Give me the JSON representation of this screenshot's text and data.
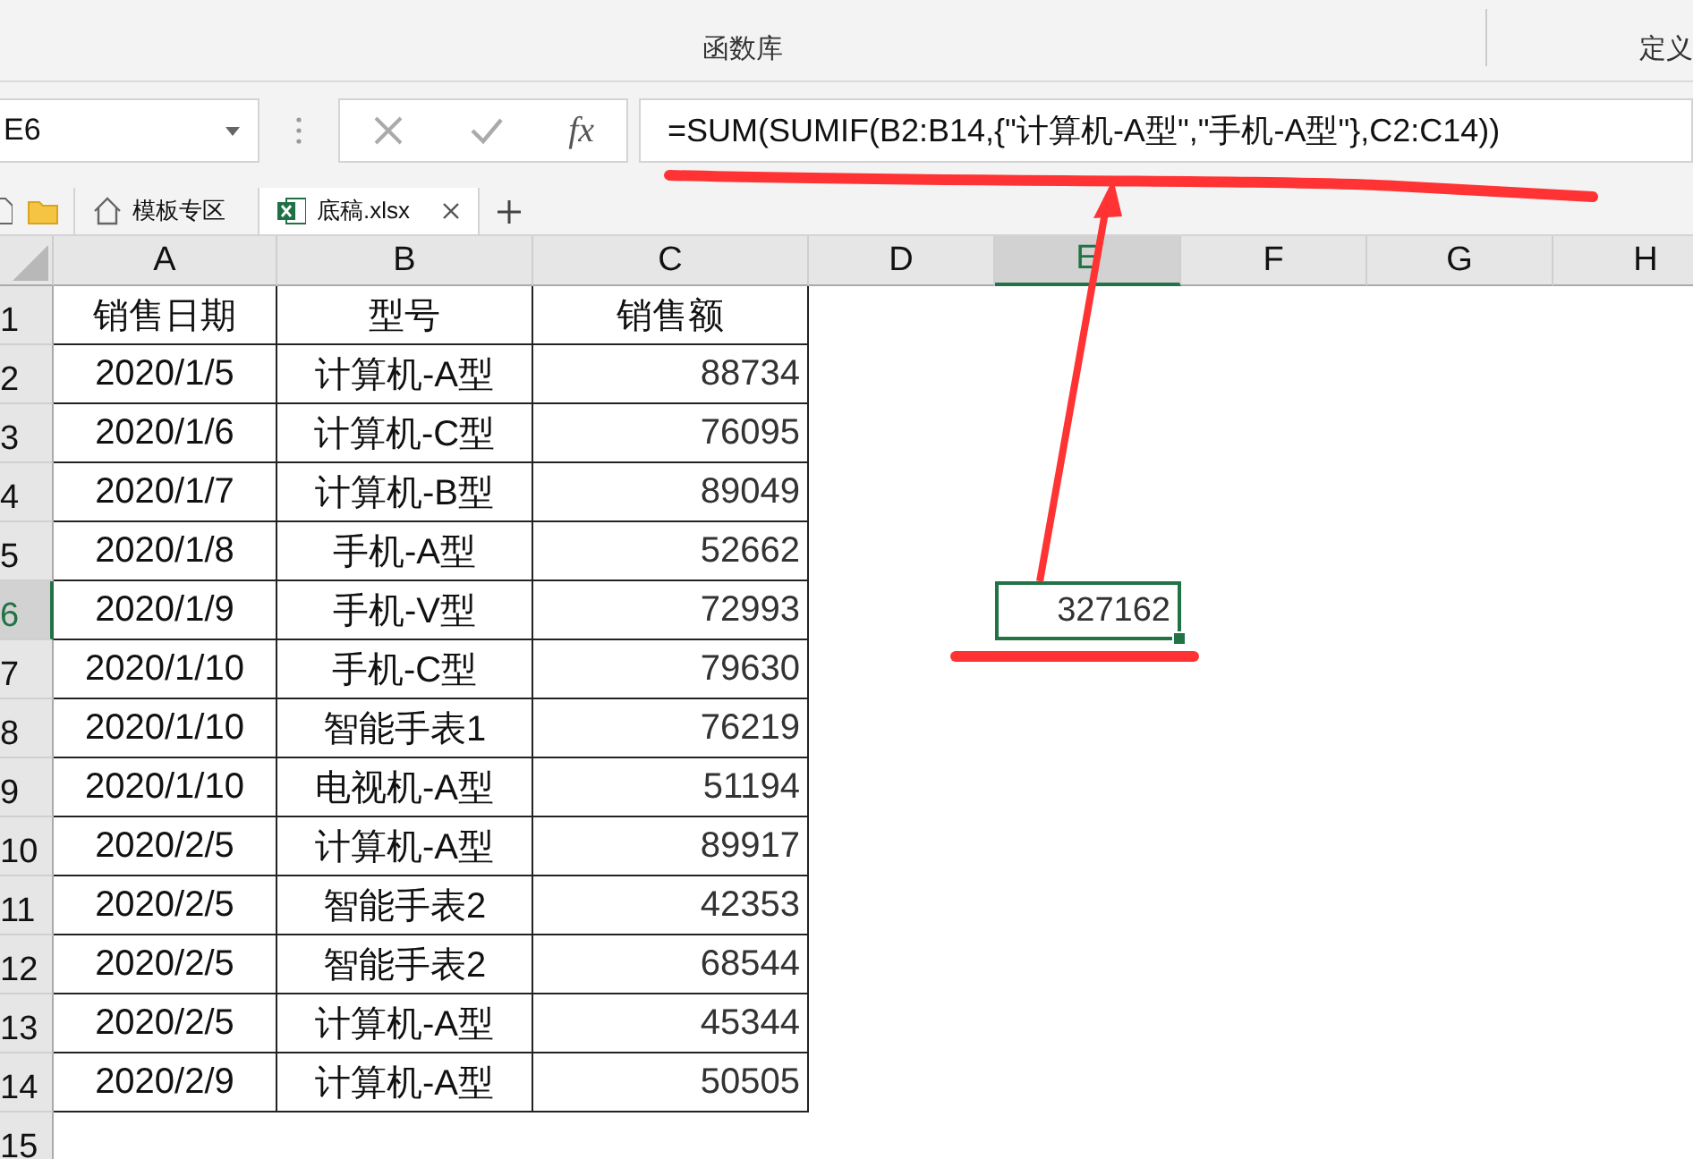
{
  "ribbon": {
    "group_label": "函数库",
    "next_group_label": "定义"
  },
  "name_box": {
    "value": "E6"
  },
  "formula_bar": {
    "function_label": "fx",
    "formula": "=SUM(SUMIF(B2:B14,{\"计算机-A型\",\"手机-A型\"},C2:C14))"
  },
  "tabs": [
    {
      "label": "模板专区",
      "kind": "home",
      "selected": false
    },
    {
      "label": "底稿.xlsx",
      "kind": "excel",
      "selected": true
    }
  ],
  "columns": [
    {
      "label": "A",
      "selected": false
    },
    {
      "label": "B",
      "selected": false
    },
    {
      "label": "C",
      "selected": false
    },
    {
      "label": "D",
      "selected": false
    },
    {
      "label": "E",
      "selected": true
    },
    {
      "label": "F",
      "selected": false
    },
    {
      "label": "G",
      "selected": false
    },
    {
      "label": "H",
      "selected": false
    }
  ],
  "rows": [
    {
      "number": "1",
      "selected": false,
      "cells": [
        "销售日期",
        "型号",
        "销售额"
      ]
    },
    {
      "number": "2",
      "selected": false,
      "cells": [
        "2020/1/5",
        "计算机-A型",
        "88734"
      ]
    },
    {
      "number": "3",
      "selected": false,
      "cells": [
        "2020/1/6",
        "计算机-C型",
        "76095"
      ]
    },
    {
      "number": "4",
      "selected": false,
      "cells": [
        "2020/1/7",
        "计算机-B型",
        "89049"
      ]
    },
    {
      "number": "5",
      "selected": false,
      "cells": [
        "2020/1/8",
        "手机-A型",
        "52662"
      ]
    },
    {
      "number": "6",
      "selected": true,
      "cells": [
        "2020/1/9",
        "手机-V型",
        "72993"
      ],
      "column_e": {
        "value": "327162",
        "selected": true
      }
    },
    {
      "number": "7",
      "selected": false,
      "cells": [
        "2020/1/10",
        "手机-C型",
        "79630"
      ]
    },
    {
      "number": "8",
      "selected": false,
      "cells": [
        "2020/1/10",
        "智能手表1",
        "76219"
      ]
    },
    {
      "number": "9",
      "selected": false,
      "cells": [
        "2020/1/10",
        "电视机-A型",
        "51194"
      ]
    },
    {
      "number": "10",
      "selected": false,
      "cells": [
        "2020/2/5",
        "计算机-A型",
        "89917"
      ]
    },
    {
      "number": "11",
      "selected": false,
      "cells": [
        "2020/2/5",
        "智能手表2",
        "42353"
      ]
    },
    {
      "number": "12",
      "selected": false,
      "cells": [
        "2020/2/5",
        "智能手表2",
        "68544"
      ]
    },
    {
      "number": "13",
      "selected": false,
      "cells": [
        "2020/2/5",
        "计算机-A型",
        "45344"
      ]
    },
    {
      "number": "14",
      "selected": false,
      "cells": [
        "2020/2/9",
        "计算机-A型",
        "50505"
      ]
    },
    {
      "number": "15",
      "selected": false
    }
  ]
}
